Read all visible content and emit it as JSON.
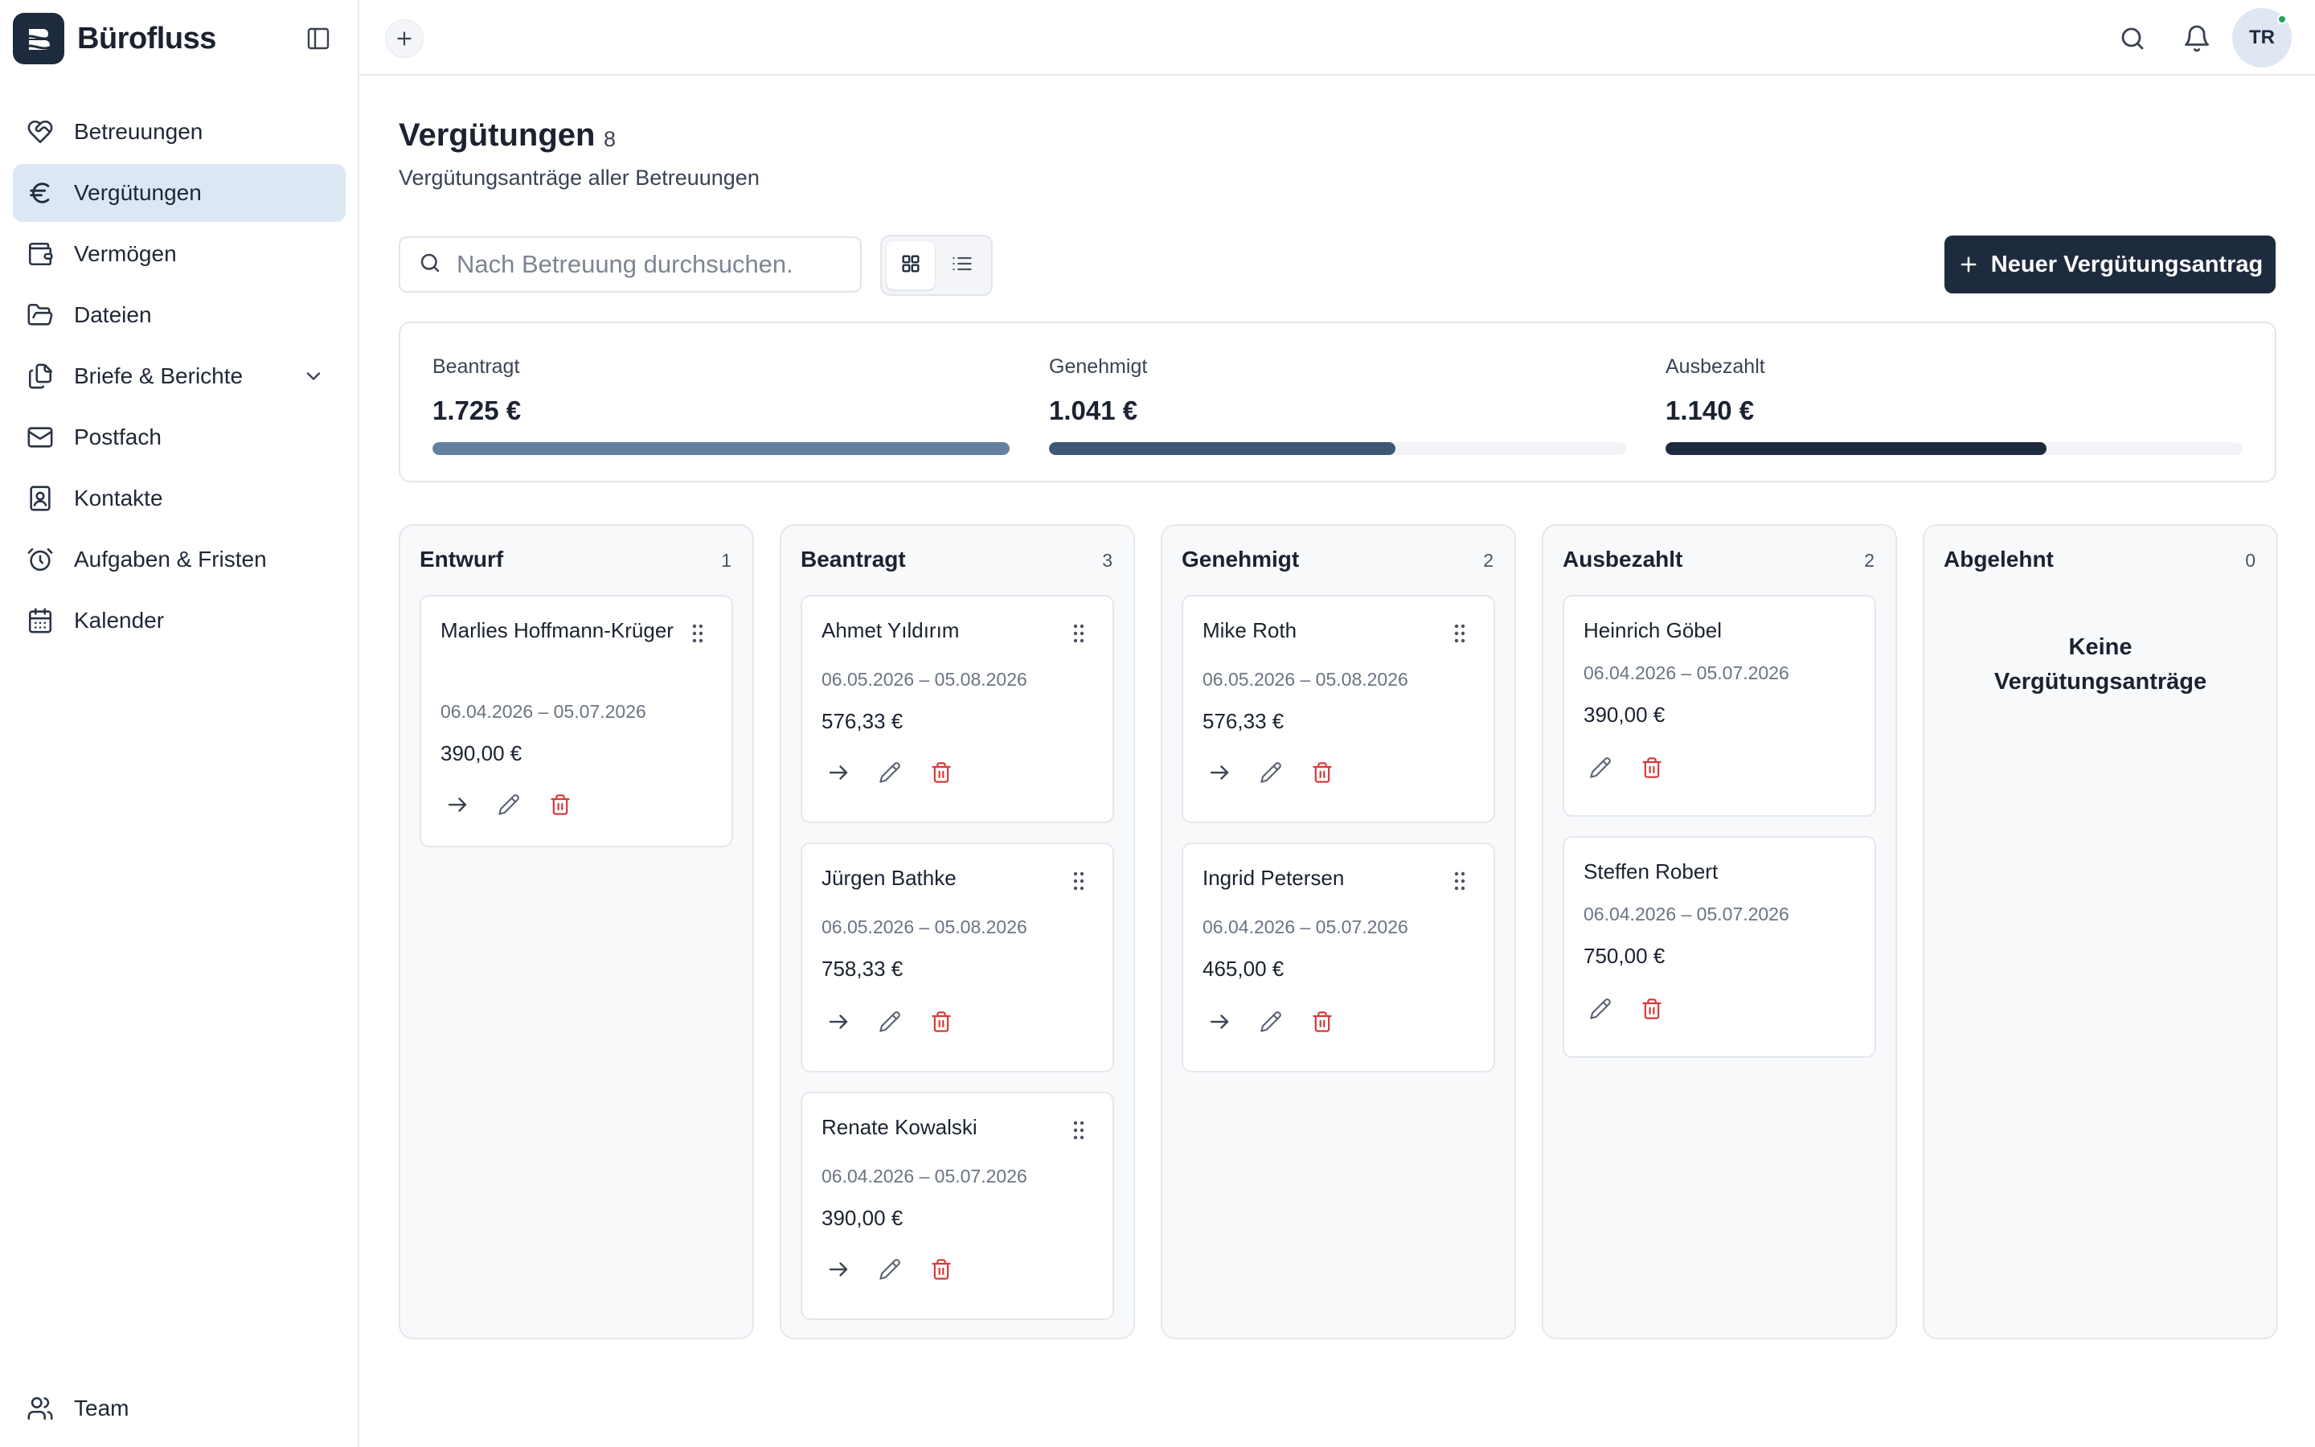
{
  "app": {
    "name": "Bürofluss",
    "accent": "#1e2b3e",
    "active_bg": "#dde7f4",
    "danger": "#d63a3a"
  },
  "sidebar": {
    "items": [
      {
        "label": "Betreuungen",
        "icon": "heart-handshake-icon"
      },
      {
        "label": "Vergütungen",
        "icon": "euro-icon",
        "active": true
      },
      {
        "label": "Vermögen",
        "icon": "wallet-icon"
      },
      {
        "label": "Dateien",
        "icon": "folder-icon"
      },
      {
        "label": "Briefe & Berichte",
        "icon": "documents-icon",
        "expandable": true
      },
      {
        "label": "Postfach",
        "icon": "mail-icon"
      },
      {
        "label": "Kontakte",
        "icon": "contact-book-icon"
      },
      {
        "label": "Aufgaben & Fristen",
        "icon": "alarm-clock-icon"
      },
      {
        "label": "Kalender",
        "icon": "calendar-icon"
      }
    ],
    "bottom": {
      "label": "Team",
      "icon": "users-icon"
    }
  },
  "topbar": {
    "avatar_initials": "TR",
    "online_color": "#22a559"
  },
  "page": {
    "title": "Vergütungen",
    "count": "8",
    "subtitle": "Vergütungsanträge aller Betreuungen"
  },
  "search": {
    "placeholder": "Nach Betreuung durchsuchen."
  },
  "view": {
    "active": "grid"
  },
  "new_button": {
    "label": "Neuer Vergütungsantrag"
  },
  "stats": [
    {
      "label": "Beantragt",
      "value": "1.725 €",
      "progress": 1.0,
      "color": "#64809f"
    },
    {
      "label": "Genehmigt",
      "value": "1.041 €",
      "progress": 0.6,
      "color": "#3d5775"
    },
    {
      "label": "Ausbezahlt",
      "value": "1.140 €",
      "progress": 0.66,
      "color": "#1e2b3e"
    }
  ],
  "board": {
    "columns": [
      {
        "title": "Entwurf",
        "count": "1",
        "cards": [
          {
            "name": "Marlies Hoffmann-Krüger",
            "period": "06.04.2026 – 05.07.2026",
            "amount": "390,00 €",
            "forward": true
          }
        ]
      },
      {
        "title": "Beantragt",
        "count": "3",
        "cards": [
          {
            "name": "Ahmet Yıldırım",
            "period": "06.05.2026 – 05.08.2026",
            "amount": "576,33 €",
            "forward": true
          },
          {
            "name": "Jürgen Bathke",
            "period": "06.05.2026 – 05.08.2026",
            "amount": "758,33 €",
            "forward": true
          },
          {
            "name": "Renate Kowalski",
            "period": "06.04.2026 – 05.07.2026",
            "amount": "390,00 €",
            "forward": true
          }
        ]
      },
      {
        "title": "Genehmigt",
        "count": "2",
        "cards": [
          {
            "name": "Mike Roth",
            "period": "06.05.2026 – 05.08.2026",
            "amount": "576,33 €",
            "forward": true
          },
          {
            "name": "Ingrid Petersen",
            "period": "06.04.2026 – 05.07.2026",
            "amount": "465,00 €",
            "forward": true
          }
        ]
      },
      {
        "title": "Ausbezahlt",
        "count": "2",
        "cards": [
          {
            "name": "Heinrich Göbel",
            "period": "06.04.2026 – 05.07.2026",
            "amount": "390,00 €",
            "forward": false
          },
          {
            "name": "Steffen Robert",
            "period": "06.04.2026 – 05.07.2026",
            "amount": "750,00 €",
            "forward": false
          }
        ]
      },
      {
        "title": "Abgelehnt",
        "count": "0",
        "cards": [],
        "empty_text": "Keine Vergütungsanträge"
      }
    ]
  }
}
